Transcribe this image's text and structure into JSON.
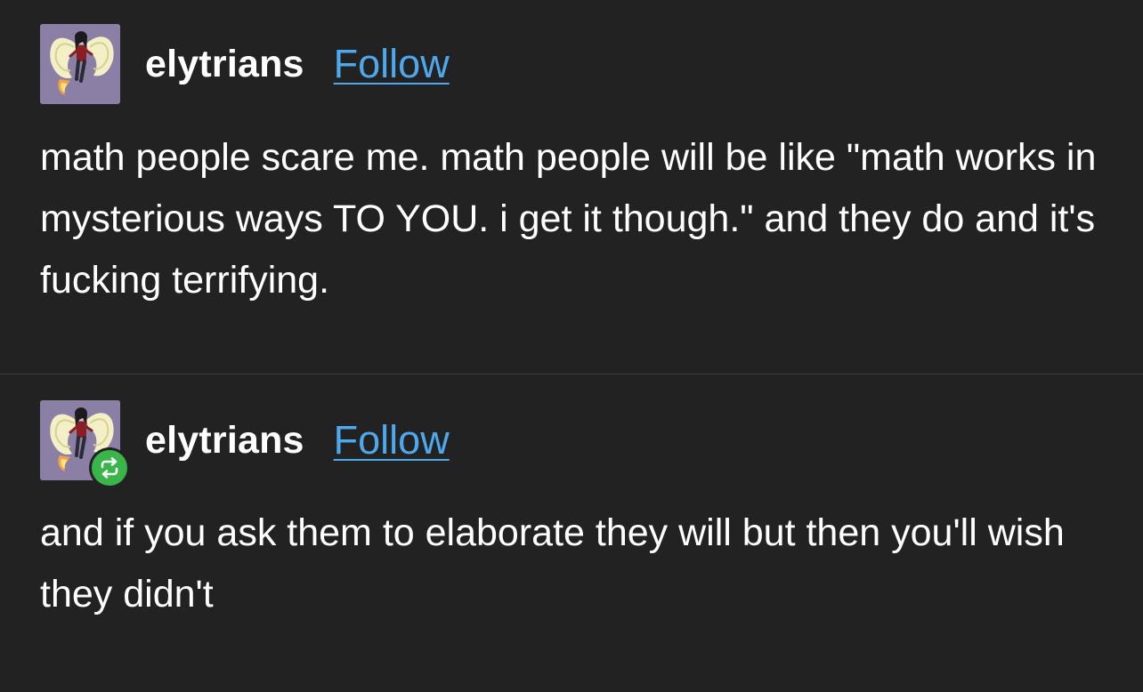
{
  "posts": [
    {
      "username": "elytrians",
      "follow_label": "Follow",
      "avatar_icon": "winged-character-avatar",
      "reblogged": false,
      "body": "math people scare me. math people will be like \"math works in mysterious ways TO YOU. i get it though.\" and they do and it's fucking terrifying."
    },
    {
      "username": "elytrians",
      "follow_label": "Follow",
      "avatar_icon": "winged-character-avatar",
      "reblogged": true,
      "reblog_icon": "reblog-icon",
      "body": "and if you ask them to elaborate they will but then you'll wish they didn't"
    }
  ],
  "colors": {
    "background": "#222222",
    "text": "#ffffff",
    "link": "#4ea8ec",
    "reblog_badge": "#3ab54a",
    "divider": "#3d3d3d"
  }
}
